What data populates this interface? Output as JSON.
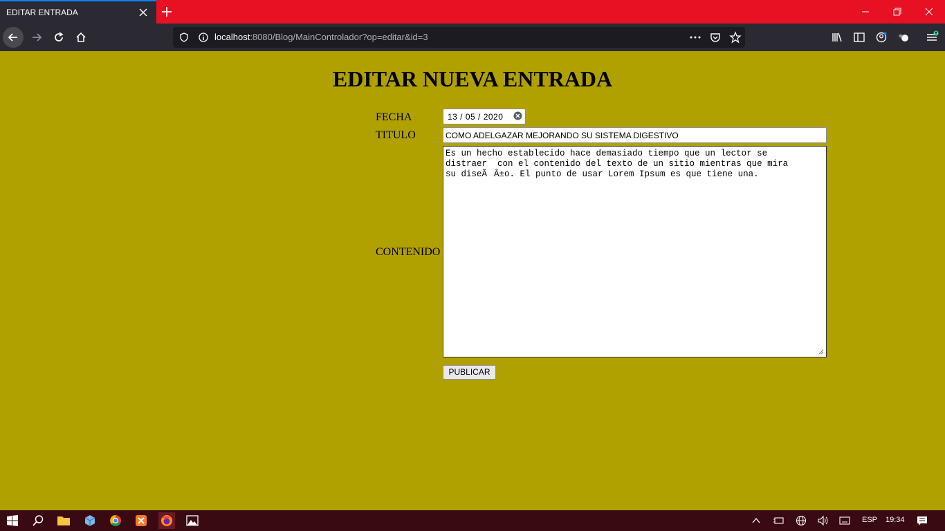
{
  "browser": {
    "tab_title": "EDITAR ENTRADA",
    "url_host": "localhost",
    "url_rest": ":8080/Blog/MainControlador?op=editar&id=3"
  },
  "page": {
    "title": "EDITAR NUEVA ENTRADA",
    "fecha_label": "FECHA",
    "fecha_value": "13 / 05 / 2020",
    "titulo_label": "TITULO",
    "titulo_value": "COMO ADELGAZAR MEJORANDO SU SISTEMA DIGESTIVO",
    "contenido_label": "CONTENIDO",
    "contenido_value": "Es un hecho establecido hace demasiado tiempo que un lector se\ndistraer  con el contenido del texto de un sitio mientras que mira\nsu diseÃÂ±o. El punto de usar Lorem Ipsum es que tiene una.",
    "publish_label": "PUBLICAR"
  },
  "taskbar": {
    "language": "ESP",
    "time": "19:34"
  },
  "colors": {
    "page_background": "#b0a000",
    "titlebar": "#e81123",
    "toolbar": "#2b2a33",
    "taskbar": "#3a0a12"
  }
}
